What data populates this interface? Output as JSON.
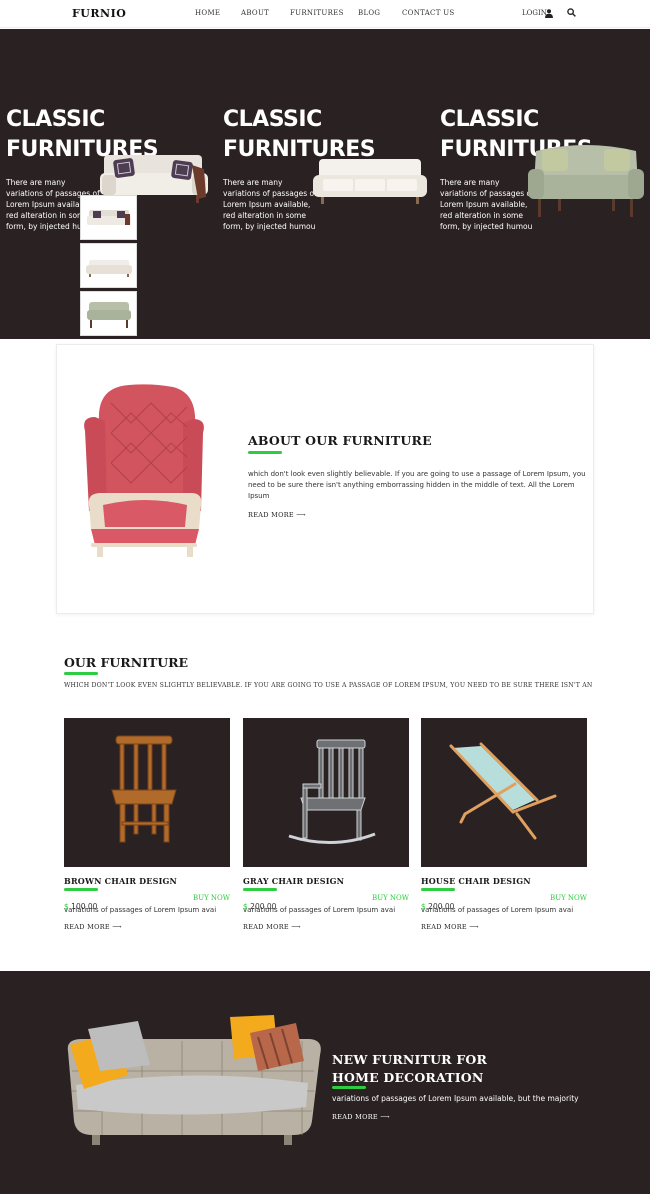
{
  "nav": {
    "logo": "FURNIO",
    "items": [
      "HOME",
      "ABOUT",
      "FURNITURES",
      "BLOG",
      "CONTACT US"
    ],
    "login": "LOGIN"
  },
  "hero": {
    "slides": [
      {
        "title_line1": "CLASSIC",
        "title_line2": "FURNITURES",
        "text": "There are many variations of passages of Lorem Ipsum available, red alteration in some form, by injected humou"
      },
      {
        "title_line1": "CLASSIC",
        "title_line2": "FURNITURES",
        "text": "There are many variations of passages of Lorem Ipsum available, red alteration in some form, by injected humou"
      },
      {
        "title_line1": "CLASSIC",
        "title_line2": "FURNITURES",
        "text": "There are many variations of passages of Lorem Ipsum available, red alteration in some form, by injected humou"
      }
    ]
  },
  "about": {
    "title": "ABOUT OUR FURNITURE",
    "text": "which don't look even slightly believable. If you are going to use a passage of Lorem Ipsum, you need to be sure there isn't anything emborrassing hidden in the middle of text. All the Lorem Ipsum",
    "read_more": "READ MORE ⟶"
  },
  "our_furniture": {
    "title": "OUR FURNITURE",
    "subtitle": "WHICH DON'T LOOK EVEN SLIGHTLY BELIEVABLE. IF YOU ARE GOING TO USE A PASSAGE OF LOREM IPSUM, YOU NEED TO BE SURE THERE ISN'T AN",
    "cards": [
      {
        "name": "BROWN CHAIR DESIGN",
        "currency": "$",
        "price": "100.00",
        "buy": "BUY NOW",
        "desc": "variations of passages of Lorem Ipsum avai",
        "read_more": "READ MORE ⟶"
      },
      {
        "name": "GRAY CHAIR DESIGN",
        "currency": "$",
        "price": "200.00",
        "buy": "BUY NOW",
        "desc": "variations of passages of Lorem Ipsum avai",
        "read_more": "READ MORE ⟶"
      },
      {
        "name": "HOUSE CHAIR DESIGN",
        "currency": "$",
        "price": "200.00",
        "buy": "BUY NOW",
        "desc": "variations of passages of Lorem Ipsum avai",
        "read_more": "READ MORE ⟶"
      }
    ]
  },
  "banner": {
    "title_line1": "NEW FURNITUR FOR",
    "title_line2": "HOME DECORATION",
    "text": "variations of passages of Lorem Ipsum available, but the majority",
    "read_more": "READ MORE ⟶"
  },
  "colors": {
    "accent": "#2ecc40",
    "dark_bg": "#2a2123"
  }
}
